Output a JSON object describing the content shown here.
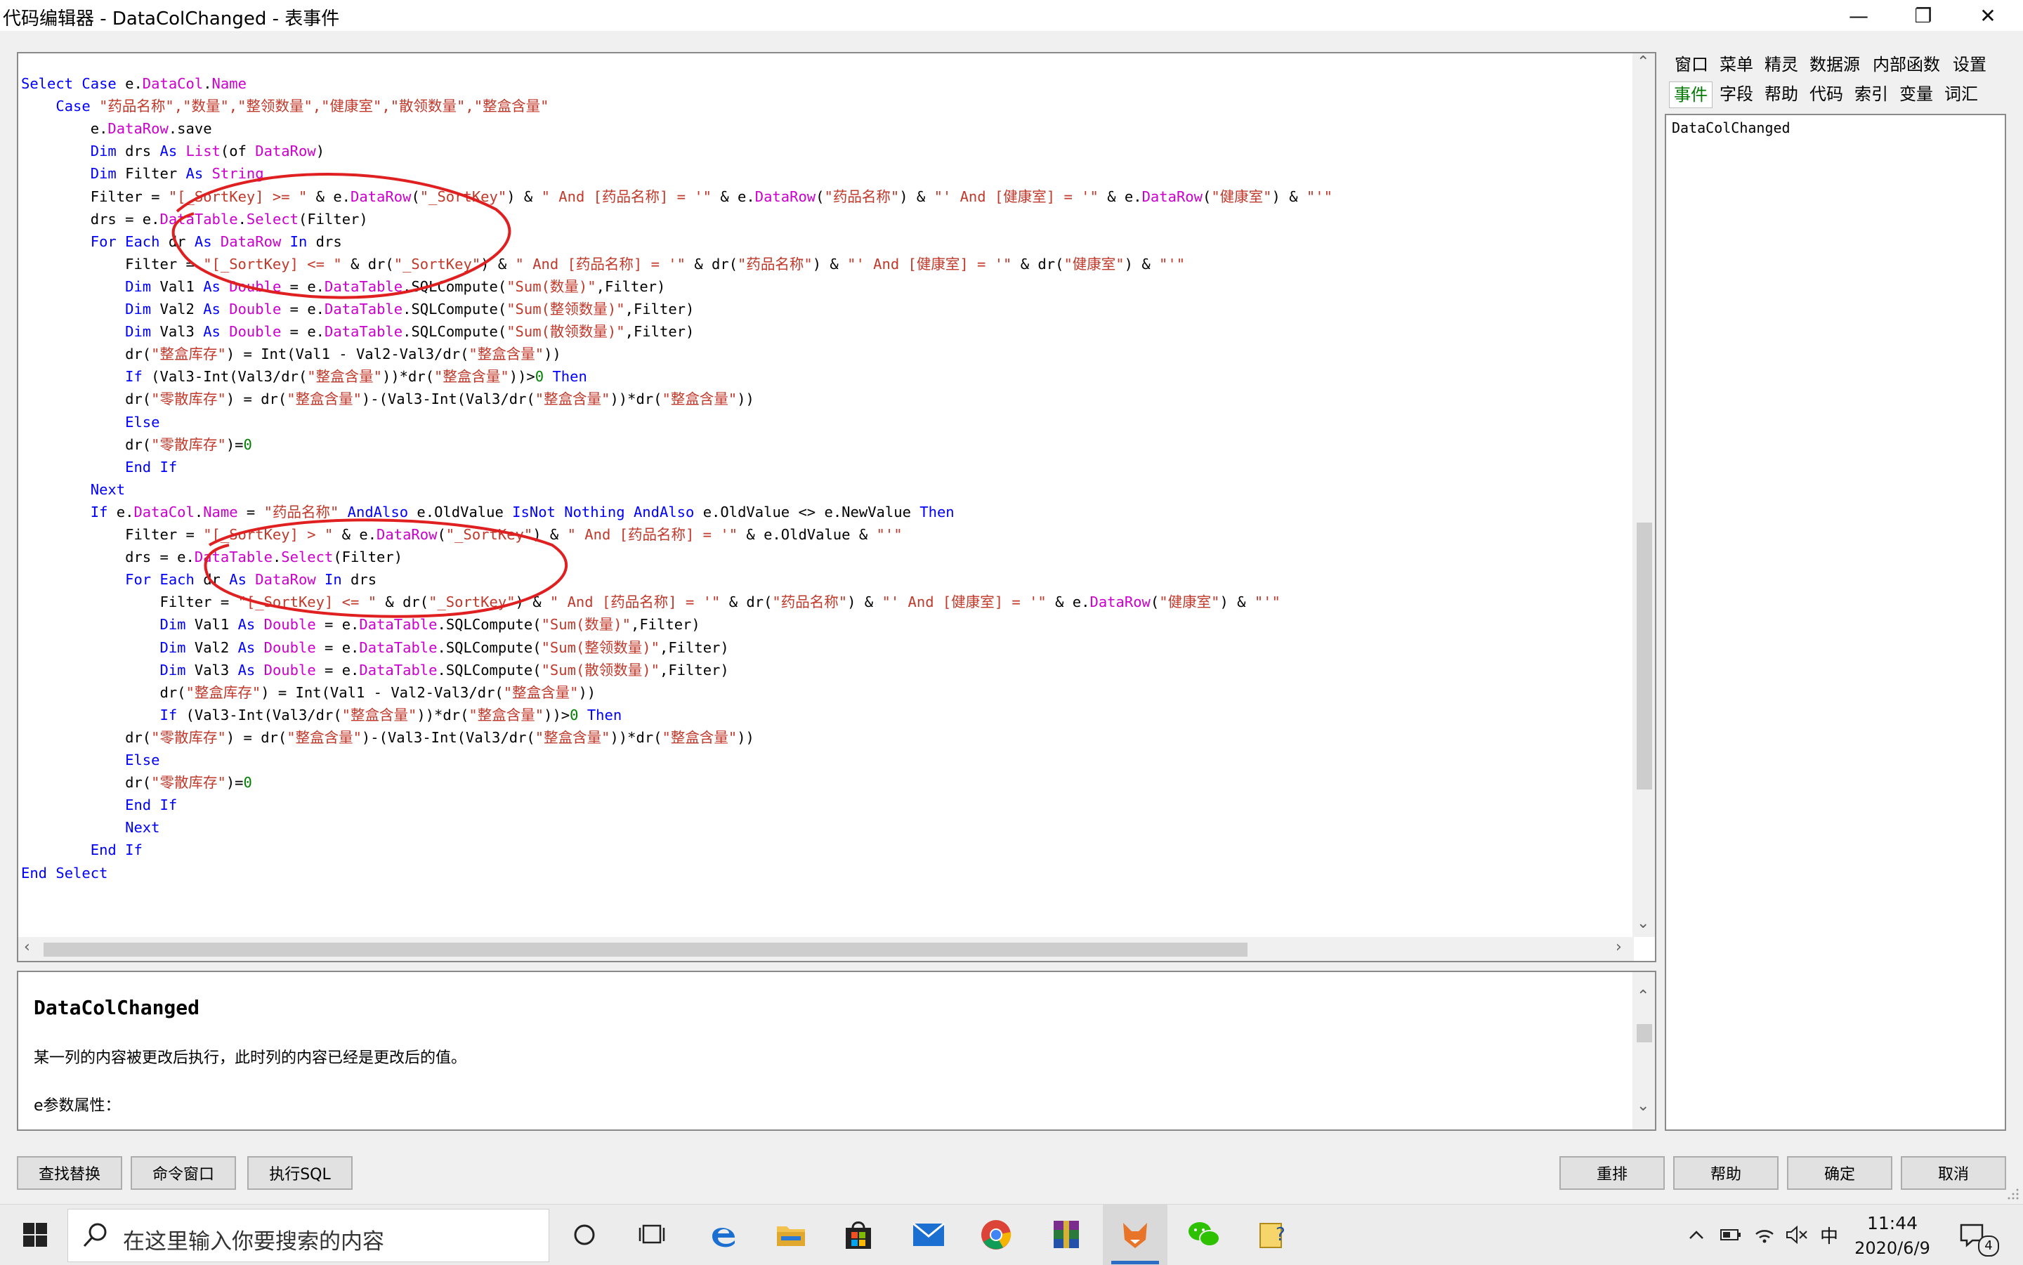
{
  "window": {
    "title": "代码编辑器 - DataColChanged - 表事件",
    "minimize_glyph": "—",
    "restore_glyph": "❐",
    "close_glyph": "✕"
  },
  "code_lines": [
    [
      {
        "t": "Select Case",
        "c": "kw"
      },
      {
        "t": " e."
      },
      {
        "t": "DataCol",
        "c": "pr"
      },
      {
        "t": "."
      },
      {
        "t": "Name",
        "c": "pr"
      }
    ],
    [
      {
        "t": "    "
      },
      {
        "t": "Case",
        "c": "kw"
      },
      {
        "t": " \"药品名称\",\"数量\",\"整领数量\",\"健康室\",\"散领数量\",\"整盒含量\"",
        "c": "st"
      }
    ],
    [
      {
        "t": "        e."
      },
      {
        "t": "DataRow",
        "c": "pr"
      },
      {
        "t": ".save"
      }
    ],
    [
      {
        "t": "        "
      },
      {
        "t": "Dim",
        "c": "kw"
      },
      {
        "t": " drs "
      },
      {
        "t": "As",
        "c": "kw"
      },
      {
        "t": " "
      },
      {
        "t": "List",
        "c": "pr"
      },
      {
        "t": "(of "
      },
      {
        "t": "DataRow",
        "c": "pr"
      },
      {
        "t": ")"
      }
    ],
    [
      {
        "t": "        "
      },
      {
        "t": "Dim",
        "c": "kw"
      },
      {
        "t": " Filter "
      },
      {
        "t": "As",
        "c": "kw"
      },
      {
        "t": " "
      },
      {
        "t": "String",
        "c": "pr"
      }
    ],
    [
      {
        "t": "        Filter = "
      },
      {
        "t": "\"[_SortKey] >= \"",
        "c": "st"
      },
      {
        "t": " & e."
      },
      {
        "t": "DataRow",
        "c": "pr"
      },
      {
        "t": "("
      },
      {
        "t": "\"_SortKey\"",
        "c": "st"
      },
      {
        "t": ") & "
      },
      {
        "t": "\" And [药品名称] = '\"",
        "c": "st"
      },
      {
        "t": " & e."
      },
      {
        "t": "DataRow",
        "c": "pr"
      },
      {
        "t": "("
      },
      {
        "t": "\"药品名称\"",
        "c": "st"
      },
      {
        "t": ") & "
      },
      {
        "t": "\"' And [健康室] = '\"",
        "c": "st"
      },
      {
        "t": " & e."
      },
      {
        "t": "DataRow",
        "c": "pr"
      },
      {
        "t": "("
      },
      {
        "t": "\"健康室\"",
        "c": "st"
      },
      {
        "t": ") & "
      },
      {
        "t": "\"'\"",
        "c": "st"
      }
    ],
    [
      {
        "t": "        drs = e."
      },
      {
        "t": "DataTable",
        "c": "pr"
      },
      {
        "t": "."
      },
      {
        "t": "Select",
        "c": "pr"
      },
      {
        "t": "(Filter)"
      }
    ],
    [
      {
        "t": "        "
      },
      {
        "t": "For Each",
        "c": "kw"
      },
      {
        "t": " dr "
      },
      {
        "t": "As",
        "c": "kw"
      },
      {
        "t": " "
      },
      {
        "t": "DataRow",
        "c": "pr"
      },
      {
        "t": " "
      },
      {
        "t": "In",
        "c": "kw"
      },
      {
        "t": " drs"
      }
    ],
    [
      {
        "t": "            Filter = "
      },
      {
        "t": "\"[_SortKey] <= \"",
        "c": "st"
      },
      {
        "t": " & dr("
      },
      {
        "t": "\"_SortKey\"",
        "c": "st"
      },
      {
        "t": ") & "
      },
      {
        "t": "\" And [药品名称] = '\"",
        "c": "st"
      },
      {
        "t": " & dr("
      },
      {
        "t": "\"药品名称\"",
        "c": "st"
      },
      {
        "t": ") & "
      },
      {
        "t": "\"' And [健康室] = '\"",
        "c": "st"
      },
      {
        "t": " & dr("
      },
      {
        "t": "\"健康室\"",
        "c": "st"
      },
      {
        "t": ") & "
      },
      {
        "t": "\"'\"",
        "c": "st"
      }
    ],
    [
      {
        "t": "            "
      },
      {
        "t": "Dim",
        "c": "kw"
      },
      {
        "t": " Val1 "
      },
      {
        "t": "As",
        "c": "kw"
      },
      {
        "t": " "
      },
      {
        "t": "Double",
        "c": "pr"
      },
      {
        "t": " = e."
      },
      {
        "t": "DataTable",
        "c": "pr"
      },
      {
        "t": ".SQLCompute("
      },
      {
        "t": "\"Sum(数量)\"",
        "c": "st"
      },
      {
        "t": ",Filter)"
      }
    ],
    [
      {
        "t": "            "
      },
      {
        "t": "Dim",
        "c": "kw"
      },
      {
        "t": " Val2 "
      },
      {
        "t": "As",
        "c": "kw"
      },
      {
        "t": " "
      },
      {
        "t": "Double",
        "c": "pr"
      },
      {
        "t": " = e."
      },
      {
        "t": "DataTable",
        "c": "pr"
      },
      {
        "t": ".SQLCompute("
      },
      {
        "t": "\"Sum(整领数量)\"",
        "c": "st"
      },
      {
        "t": ",Filter)"
      }
    ],
    [
      {
        "t": "            "
      },
      {
        "t": "Dim",
        "c": "kw"
      },
      {
        "t": " Val3 "
      },
      {
        "t": "As",
        "c": "kw"
      },
      {
        "t": " "
      },
      {
        "t": "Double",
        "c": "pr"
      },
      {
        "t": " = e."
      },
      {
        "t": "DataTable",
        "c": "pr"
      },
      {
        "t": ".SQLCompute("
      },
      {
        "t": "\"Sum(散领数量)\"",
        "c": "st"
      },
      {
        "t": ",Filter)"
      }
    ],
    [
      {
        "t": "            dr("
      },
      {
        "t": "\"整盒库存\"",
        "c": "st"
      },
      {
        "t": ") = Int(Val1 - Val2-Val3/dr("
      },
      {
        "t": "\"整盒含量\"",
        "c": "st"
      },
      {
        "t": "))"
      }
    ],
    [
      {
        "t": "            "
      },
      {
        "t": "If",
        "c": "kw"
      },
      {
        "t": " (Val3-Int(Val3/dr("
      },
      {
        "t": "\"整盒含量\"",
        "c": "st"
      },
      {
        "t": "))*dr("
      },
      {
        "t": "\"整盒含量\"",
        "c": "st"
      },
      {
        "t": "))>"
      },
      {
        "t": "0",
        "c": "gr"
      },
      {
        "t": " "
      },
      {
        "t": "Then",
        "c": "kw"
      }
    ],
    [
      {
        "t": "            dr("
      },
      {
        "t": "\"零散库存\"",
        "c": "st"
      },
      {
        "t": ") = dr("
      },
      {
        "t": "\"整盒含量\"",
        "c": "st"
      },
      {
        "t": ")-(Val3-Int(Val3/dr("
      },
      {
        "t": "\"整盒含量\"",
        "c": "st"
      },
      {
        "t": "))*dr("
      },
      {
        "t": "\"整盒含量\"",
        "c": "st"
      },
      {
        "t": "))"
      }
    ],
    [
      {
        "t": "            "
      },
      {
        "t": "Else",
        "c": "kw"
      }
    ],
    [
      {
        "t": "            dr("
      },
      {
        "t": "\"零散库存\"",
        "c": "st"
      },
      {
        "t": ")="
      },
      {
        "t": "0",
        "c": "gr"
      }
    ],
    [
      {
        "t": "            "
      },
      {
        "t": "End If",
        "c": "kw"
      }
    ],
    [
      {
        "t": "        "
      },
      {
        "t": "Next",
        "c": "kw"
      }
    ],
    [
      {
        "t": "        "
      },
      {
        "t": "If",
        "c": "kw"
      },
      {
        "t": " e."
      },
      {
        "t": "DataCol",
        "c": "pr"
      },
      {
        "t": "."
      },
      {
        "t": "Name",
        "c": "pr"
      },
      {
        "t": " = "
      },
      {
        "t": "\"药品名称\"",
        "c": "st"
      },
      {
        "t": " "
      },
      {
        "t": "AndAlso",
        "c": "kw"
      },
      {
        "t": " e.OldValue "
      },
      {
        "t": "IsNot Nothing AndAlso",
        "c": "kw"
      },
      {
        "t": " e.OldValue <> e.NewValue "
      },
      {
        "t": "Then",
        "c": "kw"
      }
    ],
    [
      {
        "t": "            Filter = "
      },
      {
        "t": "\"[_SortKey] > \"",
        "c": "st"
      },
      {
        "t": " & e."
      },
      {
        "t": "DataRow",
        "c": "pr"
      },
      {
        "t": "("
      },
      {
        "t": "\"_SortKey\"",
        "c": "st"
      },
      {
        "t": ") & "
      },
      {
        "t": "\" And [药品名称] = '\"",
        "c": "st"
      },
      {
        "t": " & e.OldValue & "
      },
      {
        "t": "\"'\"",
        "c": "st"
      }
    ],
    [
      {
        "t": "            drs = e."
      },
      {
        "t": "DataTable",
        "c": "pr"
      },
      {
        "t": "."
      },
      {
        "t": "Select",
        "c": "pr"
      },
      {
        "t": "(Filter)"
      }
    ],
    [
      {
        "t": "            "
      },
      {
        "t": "For Each",
        "c": "kw"
      },
      {
        "t": " dr "
      },
      {
        "t": "As",
        "c": "kw"
      },
      {
        "t": " "
      },
      {
        "t": "DataRow",
        "c": "pr"
      },
      {
        "t": " "
      },
      {
        "t": "In",
        "c": "kw"
      },
      {
        "t": " drs"
      }
    ],
    [
      {
        "t": "                Filter = "
      },
      {
        "t": "\"[_SortKey] <= \"",
        "c": "st"
      },
      {
        "t": " & dr("
      },
      {
        "t": "\"_SortKey\"",
        "c": "st"
      },
      {
        "t": ") & "
      },
      {
        "t": "\" And [药品名称] = '\"",
        "c": "st"
      },
      {
        "t": " & dr("
      },
      {
        "t": "\"药品名称\"",
        "c": "st"
      },
      {
        "t": ") & "
      },
      {
        "t": "\"' And [健康室] = '\"",
        "c": "st"
      },
      {
        "t": " & e."
      },
      {
        "t": "DataRow",
        "c": "pr"
      },
      {
        "t": "("
      },
      {
        "t": "\"健康室\"",
        "c": "st"
      },
      {
        "t": ") & "
      },
      {
        "t": "\"'\"",
        "c": "st"
      }
    ],
    [
      {
        "t": "                "
      },
      {
        "t": "Dim",
        "c": "kw"
      },
      {
        "t": " Val1 "
      },
      {
        "t": "As",
        "c": "kw"
      },
      {
        "t": " "
      },
      {
        "t": "Double",
        "c": "pr"
      },
      {
        "t": " = e."
      },
      {
        "t": "DataTable",
        "c": "pr"
      },
      {
        "t": ".SQLCompute("
      },
      {
        "t": "\"Sum(数量)\"",
        "c": "st"
      },
      {
        "t": ",Filter)"
      }
    ],
    [
      {
        "t": "                "
      },
      {
        "t": "Dim",
        "c": "kw"
      },
      {
        "t": " Val2 "
      },
      {
        "t": "As",
        "c": "kw"
      },
      {
        "t": " "
      },
      {
        "t": "Double",
        "c": "pr"
      },
      {
        "t": " = e."
      },
      {
        "t": "DataTable",
        "c": "pr"
      },
      {
        "t": ".SQLCompute("
      },
      {
        "t": "\"Sum(整领数量)\"",
        "c": "st"
      },
      {
        "t": ",Filter)"
      }
    ],
    [
      {
        "t": "                "
      },
      {
        "t": "Dim",
        "c": "kw"
      },
      {
        "t": " Val3 "
      },
      {
        "t": "As",
        "c": "kw"
      },
      {
        "t": " "
      },
      {
        "t": "Double",
        "c": "pr"
      },
      {
        "t": " = e."
      },
      {
        "t": "DataTable",
        "c": "pr"
      },
      {
        "t": ".SQLCompute("
      },
      {
        "t": "\"Sum(散领数量)\"",
        "c": "st"
      },
      {
        "t": ",Filter)"
      }
    ],
    [
      {
        "t": "                dr("
      },
      {
        "t": "\"整盒库存\"",
        "c": "st"
      },
      {
        "t": ") = Int(Val1 - Val2-Val3/dr("
      },
      {
        "t": "\"整盒含量\"",
        "c": "st"
      },
      {
        "t": "))"
      }
    ],
    [
      {
        "t": "                "
      },
      {
        "t": "If",
        "c": "kw"
      },
      {
        "t": " (Val3-Int(Val3/dr("
      },
      {
        "t": "\"整盒含量\"",
        "c": "st"
      },
      {
        "t": "))*dr("
      },
      {
        "t": "\"整盒含量\"",
        "c": "st"
      },
      {
        "t": "))>"
      },
      {
        "t": "0",
        "c": "gr"
      },
      {
        "t": " "
      },
      {
        "t": "Then",
        "c": "kw"
      }
    ],
    [
      {
        "t": "            dr("
      },
      {
        "t": "\"零散库存\"",
        "c": "st"
      },
      {
        "t": ") = dr("
      },
      {
        "t": "\"整盒含量\"",
        "c": "st"
      },
      {
        "t": ")-(Val3-Int(Val3/dr("
      },
      {
        "t": "\"整盒含量\"",
        "c": "st"
      },
      {
        "t": "))*dr("
      },
      {
        "t": "\"整盒含量\"",
        "c": "st"
      },
      {
        "t": "))"
      }
    ],
    [
      {
        "t": "            "
      },
      {
        "t": "Else",
        "c": "kw"
      }
    ],
    [
      {
        "t": "            dr("
      },
      {
        "t": "\"零散库存\"",
        "c": "st"
      },
      {
        "t": ")="
      },
      {
        "t": "0",
        "c": "gr"
      }
    ],
    [
      {
        "t": "            "
      },
      {
        "t": "End If",
        "c": "kw"
      }
    ],
    [
      {
        "t": "            "
      },
      {
        "t": "Next",
        "c": "kw"
      }
    ],
    [
      {
        "t": "        "
      },
      {
        "t": "End If",
        "c": "kw"
      }
    ],
    [
      {
        "t": "End Select",
        "c": "kw"
      }
    ]
  ],
  "syntax_colors": {
    "keyword": "#0000ff",
    "string": "#c0392b",
    "property": "#cc00cc",
    "number": "#008000",
    "annotation": "#e02020"
  },
  "help": {
    "name": "DataColChanged",
    "description": "某一列的内容被更改后执行，此时列的内容已经是更改后的值。",
    "param": "e参数属性："
  },
  "right_tabs_row1": [
    "窗口",
    "菜单",
    "精灵",
    "数据源",
    "内部函数",
    "设置"
  ],
  "right_tabs_row2": [
    "事件",
    "字段",
    "帮助",
    "代码",
    "索引",
    "变量",
    "词汇"
  ],
  "event_list": [
    "DataColChanged"
  ],
  "buttons_left": [
    "查找替换",
    "命令窗口",
    "执行SQL"
  ],
  "buttons_right": [
    "重排",
    "帮助",
    "确定",
    "取消"
  ],
  "taskbar": {
    "search_placeholder": "在这里输入你要搜索的内容",
    "time": "11:44",
    "date": "2020/6/9",
    "ime": "中",
    "notification_count": "4"
  }
}
